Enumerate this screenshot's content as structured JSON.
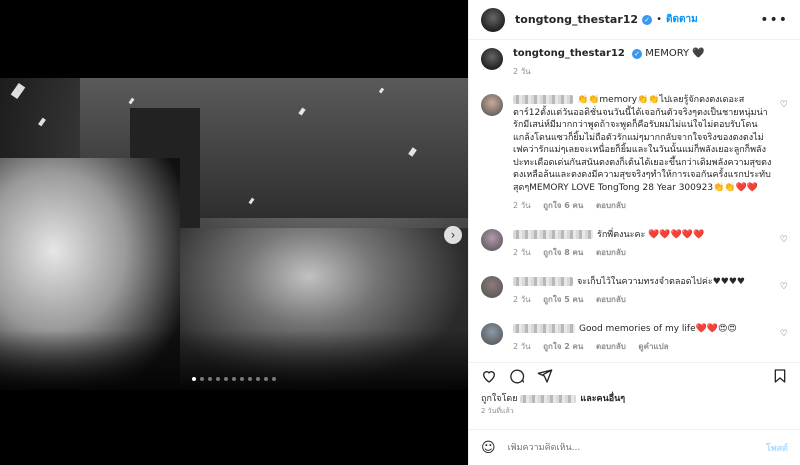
{
  "post": {
    "username": "tongtong_thestar12",
    "follow_label": "ติดตาม",
    "more_label": "•••"
  },
  "caption": {
    "username": "tongtong_thestar12",
    "text": "MEMORY 🖤",
    "time": "2 วัน"
  },
  "comments": [
    {
      "text": "👏👏memory👏👏ไปเลยรู้จักตงตงเดอะสตาร์12ตั้งแต่วันออดิชั่นจนวันนี้ได้เจอกันตัวจริงๆตงเป็นชายหนุ่มน่ารักมีเสน่ห์มีมากกว่าพูดถ้าจะพูดก็คือรับผมไม่แน่ใจไม่ตอบรับโดนแกล้งโดนแซวก็ยิ้มไม่ถือตัวรักแม่ๆมากกลับจากใจจริงของตงตงไม่เฟคว่ารักแม่ๆเลยจะเหนื่อยก็ยิ้มและในวันนั้นแม่ก็พลังเยอะลูกก็พลังปะทะเดือดเด่นกันสนันตงตงก็เต้นได้เยอะขึ้นกว่าเดิมพลังความสุขตงตงเหลือล้นและตงตงมีความสุขจริงๆทำให้การเจอกันครั้งแรกประทับสุดๆMEMORY LOVE TongTong 28 Year 300923👏👏❤️❤️",
      "time": "2 วัน",
      "likes": "ถูกใจ 6 คน",
      "reply": "ตอบกลับ",
      "translate": "",
      "avatar_color": "#c9a99a",
      "blur_width": 60
    },
    {
      "text": "รักพี่ตงนะคะ ❤️❤️❤️❤️❤️",
      "time": "2 วัน",
      "likes": "ถูกใจ 8 คน",
      "reply": "ตอบกลับ",
      "translate": "",
      "avatar_color": "#b39ab0",
      "blur_width": 80
    },
    {
      "text": "จะเก็บไว้ในความทรงจำตลอดไปค่ะ♥♥♥♥",
      "time": "2 วัน",
      "likes": "ถูกใจ 5 คน",
      "reply": "ตอบกลับ",
      "translate": "",
      "avatar_color": "#8e7a7a",
      "blur_width": 60
    },
    {
      "text": "Good memories of my life❤️❤️😍😍",
      "time": "2 วัน",
      "likes": "ถูกใจ 2 คน",
      "reply": "ตอบกลับ",
      "translate": "ดูคำแปล",
      "avatar_color": "#8a9aa8",
      "blur_width": 62
    }
  ],
  "likes_line": {
    "prefix": "ถูกใจโดย",
    "suffix": "และคนอื่นๆ"
  },
  "posted": "2 วันที่แล้ว",
  "composer": {
    "placeholder": "เพิ่มความคิดเห็น...",
    "post_label": "โพสต์"
  },
  "carousel": {
    "total": 11,
    "active": 0
  }
}
